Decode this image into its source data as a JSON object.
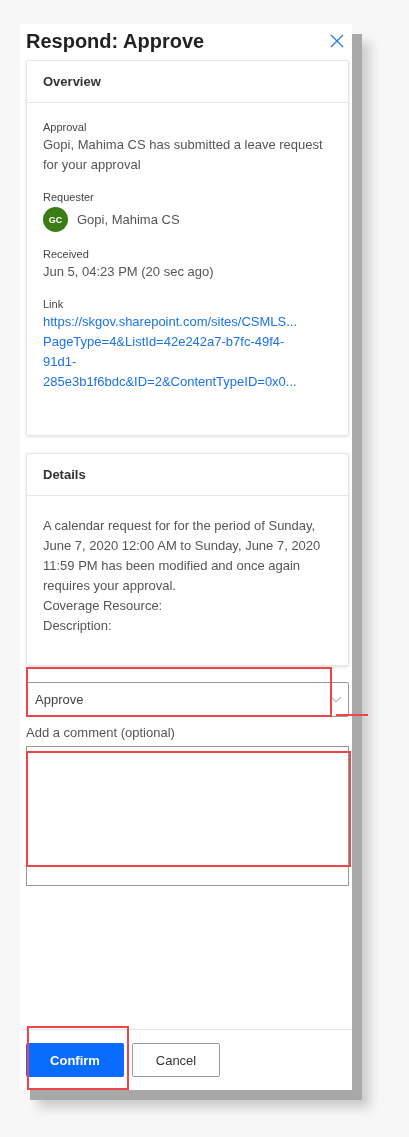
{
  "panel": {
    "title": "Respond: Approve"
  },
  "overview": {
    "heading": "Overview",
    "fields": [
      {
        "kind": "text",
        "label": "Approval",
        "value": "Gopi, Mahima CS has submitted a leave request for your approval"
      },
      {
        "kind": "person",
        "label": "Requester",
        "initials": "GC",
        "value": "Gopi, Mahima CS"
      },
      {
        "kind": "text",
        "label": "Received",
        "value": "Jun 5, 04:23 PM (20 sec ago)"
      },
      {
        "kind": "link",
        "label": "Link",
        "lines": [
          "https://skgov.sharepoint.com/sites/CSMLS...",
          "PageType=4&ListId=42e242a7-b7fc-49f4-",
          "91d1-",
          "285e3b1f6bdc&ID=2&ContentTypeID=0x0..."
        ]
      }
    ]
  },
  "details": {
    "heading": "Details",
    "paragraphs": [
      "A calendar request for  for the period of Sunday, June 7, 2020 12:00 AM to Sunday, June 7, 2020 11:59 PM has been modified and once again requires your approval.",
      "Coverage Resource:",
      "Description:"
    ]
  },
  "response": {
    "value": "Approve"
  },
  "comment": {
    "label": "Add a comment (optional)"
  },
  "buttons": [
    {
      "label": "Confirm",
      "kind": "primary"
    },
    {
      "label": "Cancel",
      "kind": "secondary"
    }
  ]
}
